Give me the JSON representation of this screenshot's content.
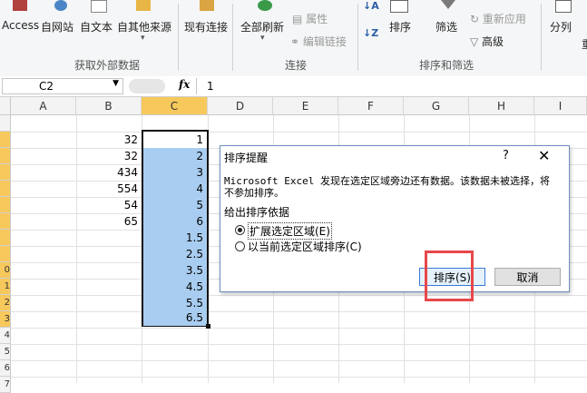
{
  "ribbon": {
    "access_label": "Access",
    "web_label": "自网站",
    "text_label": "自文本",
    "other_label": "自其他来源",
    "existing_label": "现有连接",
    "refresh_label": "全部刷新",
    "properties_label": "属性",
    "edit_links_label": "编辑链接",
    "sort_label": "排序",
    "filter_label": "筛选",
    "reapply_label": "重新应用",
    "advanced_label": "高级",
    "split_label": "分列",
    "group_external": "获取外部数据",
    "group_connections": "连接",
    "group_sort_filter": "排序和筛选"
  },
  "formula": {
    "name_box": "C2",
    "fx": "fx",
    "value": "1"
  },
  "columns": [
    "A",
    "B",
    "C",
    "D",
    "E",
    "F",
    "G",
    "H",
    "I"
  ],
  "rows": [
    {
      "b": "",
      "c": ""
    },
    {
      "b": "32",
      "c": "1"
    },
    {
      "b": "32",
      "c": "2"
    },
    {
      "b": "434",
      "c": "3"
    },
    {
      "b": "554",
      "c": "4"
    },
    {
      "b": "54",
      "c": "5"
    },
    {
      "b": "65",
      "c": "6"
    },
    {
      "b": "",
      "c": "1.5"
    },
    {
      "b": "",
      "c": "2.5"
    },
    {
      "b": "",
      "c": "3.5"
    },
    {
      "b": "",
      "c": "4.5"
    },
    {
      "b": "",
      "c": "5.5"
    },
    {
      "b": "",
      "c": "6.5"
    }
  ],
  "row_numbers": [
    "",
    "",
    "",
    "",
    "",
    "",
    "",
    "",
    "",
    "0",
    "1",
    "2",
    "3",
    "4",
    "5",
    "6",
    "7"
  ],
  "dialog": {
    "title": "排序提醒",
    "help": "?",
    "message_line1": "Microsoft Excel 发现在选定区域旁边还有数据。该数据未被选择，将",
    "message_line2": "不参加排序。",
    "group_label": "给出排序依据",
    "option_expand": "扩展选定区域(E)",
    "option_current": "以当前选定区域排序(C)",
    "sort_button": "排序(S)",
    "cancel_button": "取消"
  },
  "colors": {
    "selection": "#a9cdf0",
    "highlight_box": "#e8474a",
    "active_row_header": "#f7c85c"
  }
}
